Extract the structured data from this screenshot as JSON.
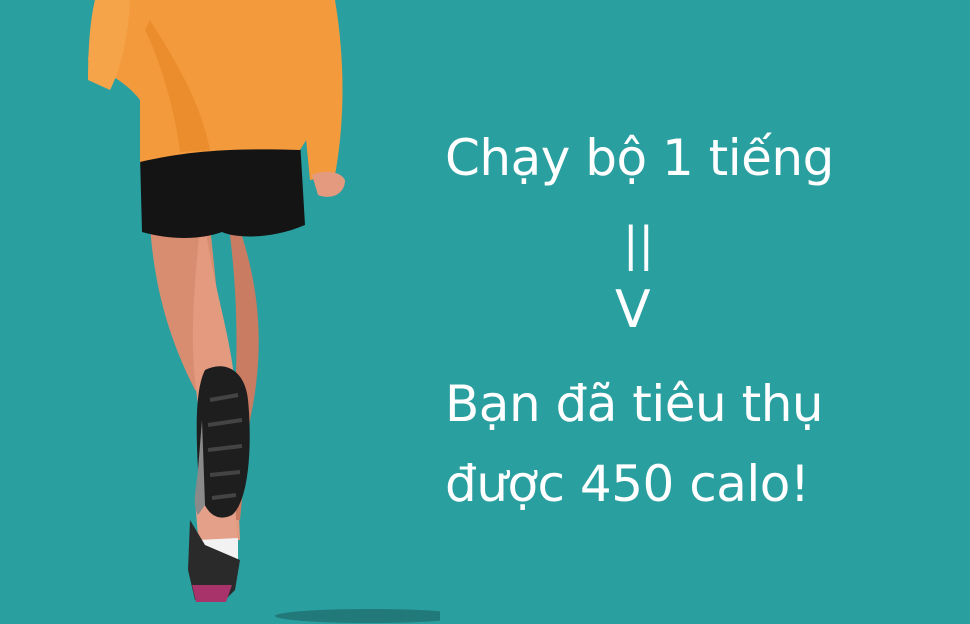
{
  "message": {
    "line1": "Chạy bộ 1 tiếng",
    "arrow_bars": "||",
    "arrow_head": "V",
    "line2": "Bạn đã tiêu thụ",
    "line3": "được 450 calo!"
  },
  "colors": {
    "background": "#2a9fa0",
    "text": "#ffffff",
    "jacket": "#f39a3c",
    "shorts": "#141414",
    "skin": "#e0957a",
    "shoe": "#1e1e1e"
  },
  "icons": {
    "illustration": "runner-illustration"
  }
}
